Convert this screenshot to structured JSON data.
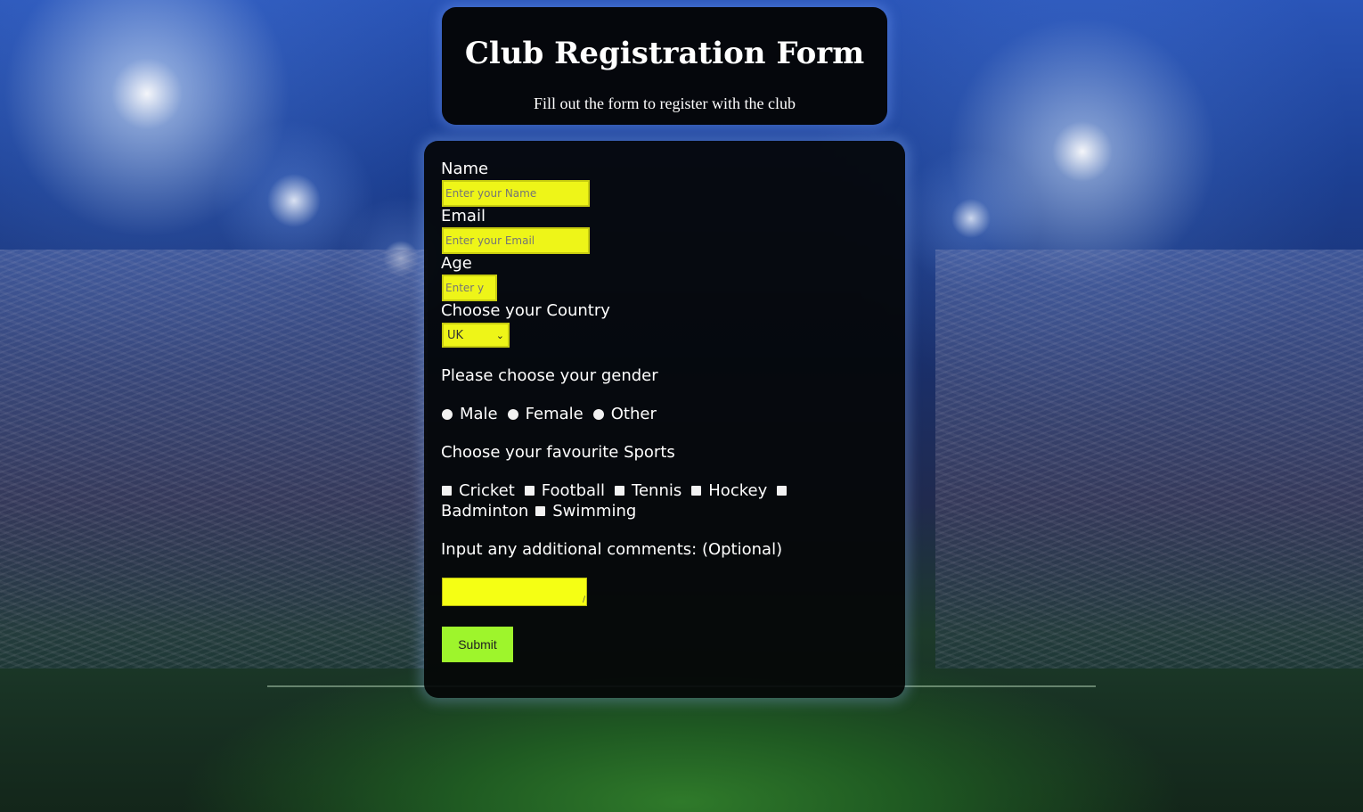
{
  "header": {
    "title": "Club Registration Form",
    "subtitle": "Fill out the form to register with the club"
  },
  "form": {
    "name": {
      "label": "Name",
      "placeholder": "Enter your Name",
      "value": ""
    },
    "email": {
      "label": "Email",
      "placeholder": "Enter your Email",
      "value": ""
    },
    "age": {
      "label": "Age",
      "placeholder": "Enter y",
      "value": ""
    },
    "country": {
      "label": "Choose your Country",
      "selected": "UK"
    },
    "gender": {
      "label": "Please choose your gender",
      "options": [
        "Male",
        "Female",
        "Other"
      ]
    },
    "sports": {
      "label": "Choose your favourite Sports",
      "options": [
        "Cricket",
        "Football",
        "Tennis",
        "Hockey",
        "Badminton",
        "Swimming"
      ]
    },
    "comments": {
      "label": "Input any additional comments: (Optional)",
      "value": ""
    },
    "submit_label": "Submit"
  },
  "colors": {
    "input_bg": "#eef518",
    "submit_bg": "#9ef52c",
    "card_bg": "#05070c"
  }
}
